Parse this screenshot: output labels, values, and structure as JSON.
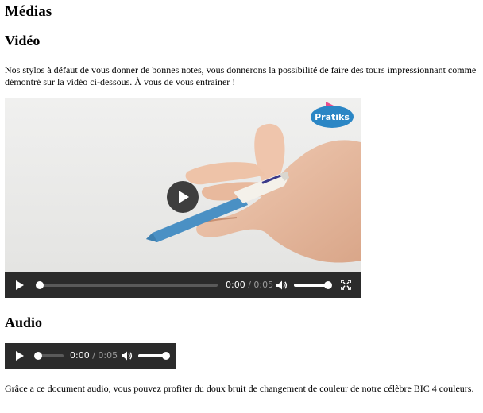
{
  "page": {
    "title": "Médias"
  },
  "video_section": {
    "heading": "Vidéo",
    "description": "Nos stylos à défaut de vous donner de bonnes notes, vous donnerons la possibilité de faire des tours impressionnant comme démontré sur la vidéo ci-dessous. À vous de vous entrainer !",
    "player": {
      "logo_text": "Pratiks",
      "current_time": "0:00",
      "separator": " / ",
      "duration": "0:05",
      "progress": 0.0,
      "volume": 1.0,
      "icons": [
        "play-icon",
        "play-icon",
        "volume-icon",
        "fullscreen-icon"
      ]
    }
  },
  "audio_section": {
    "heading": "Audio",
    "player": {
      "current_time": "0:00",
      "separator": " / ",
      "duration": "0:05",
      "progress": 0.0,
      "volume": 1.0,
      "icons": [
        "play-icon",
        "volume-icon"
      ]
    },
    "description": "Grâce a ce document audio, vous pouvez profiter du doux bruit de changement de couleur de notre célèbre BIC 4 couleurs."
  },
  "colors": {
    "control_bar": "#2b2b2b",
    "video_background": "#ececec",
    "pen_blue": "#4a90c4",
    "logo_blue": "#2b86c5",
    "logo_pink": "#e84c8b"
  }
}
